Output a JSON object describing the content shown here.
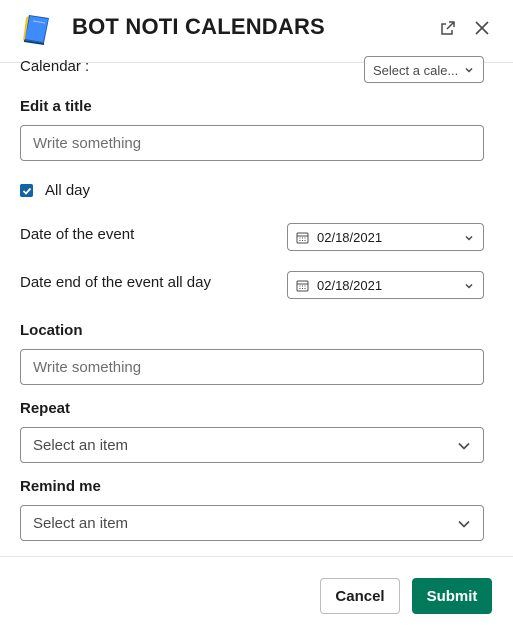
{
  "header": {
    "title": "BOT NOTI CALENDARS",
    "app_icon": "blue-book-icon",
    "external_icon": "external-link-icon",
    "close_icon": "close-icon"
  },
  "form": {
    "calendar": {
      "label": "Calendar :",
      "select_value": "Select a cale..."
    },
    "title": {
      "label": "Edit a title",
      "placeholder": "Write something"
    },
    "all_day": {
      "label": "All day",
      "checked": true
    },
    "date_start": {
      "label": "Date of the event",
      "value": "02/18/2021"
    },
    "date_end": {
      "label": "Date end of the event all day",
      "value": "02/18/2021"
    },
    "location": {
      "label": "Location",
      "placeholder": "Write something"
    },
    "repeat": {
      "label": "Repeat",
      "select_value": "Select an item"
    },
    "remind": {
      "label": "Remind me",
      "select_value": "Select an item"
    }
  },
  "footer": {
    "cancel_label": "Cancel",
    "submit_label": "Submit"
  },
  "colors": {
    "accent": "#1264a3",
    "submit": "#007a5a"
  }
}
